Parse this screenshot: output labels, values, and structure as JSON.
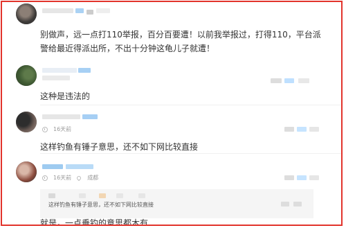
{
  "comments": [
    {
      "text": "别做声，远一点打110举报，百分百要遭！以前我举报过，打得110，平台派警给最近得派出所，不出十分钟这龟儿子就遭！"
    },
    {
      "text": "这种是违法的"
    },
    {
      "time": "16天前",
      "text": "这样钓鱼有锤子意思，还不如下网比较直接"
    },
    {
      "time": "16天前",
      "location": "成都",
      "quote": "这样钓鱼有锤子意思，还不如下网比较直接",
      "text": "就是，一点垂钓的意思都木有"
    }
  ],
  "colors": {
    "border": "#e2332b",
    "mosaic_blue": "#9ecbf0",
    "mosaic_gray": "#d9d9d9"
  }
}
